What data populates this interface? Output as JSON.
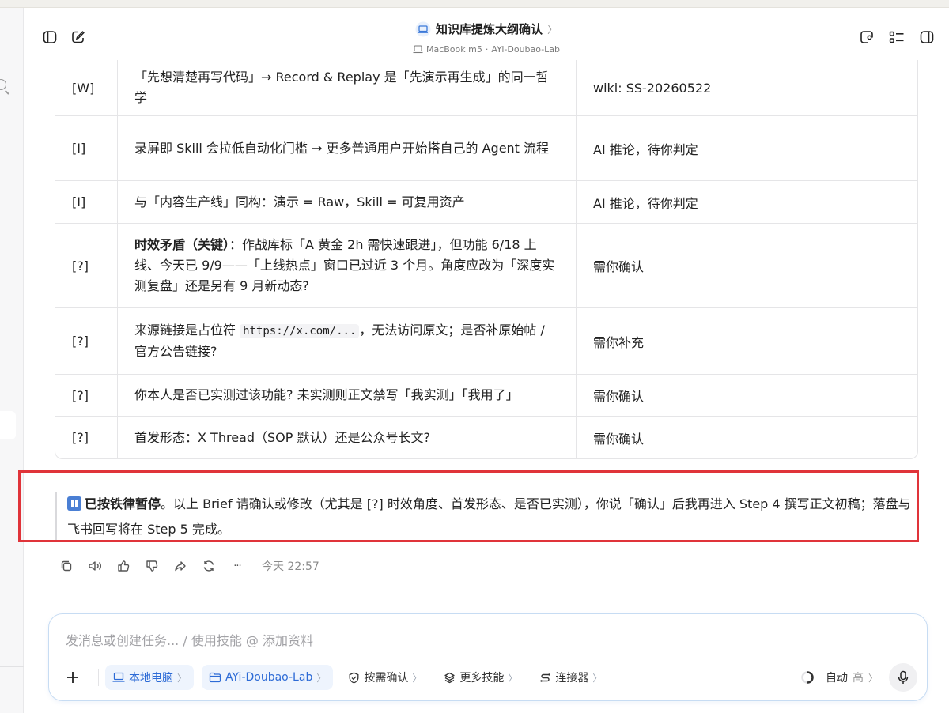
{
  "header": {
    "title": "知识库提炼大纲确认",
    "title_chevron": "〉",
    "device": "MacBook m5",
    "separator": "·",
    "workspace": "AYi-Doubao-Lab"
  },
  "table": {
    "rows": [
      {
        "tag": "[W]",
        "content": "「先想清楚再写代码」→ Record & Replay 是「先演示再生成」的同一哲学",
        "source": "wiki: SS-20260522"
      },
      {
        "tag": "[I]",
        "content": "录屏即 Skill 会拉低自动化门槛 → 更多普通用户开始搭自己的 Agent 流程",
        "source": "AI 推论，待你判定"
      },
      {
        "tag": "[I]",
        "content": "与「内容生产线」同构：演示 = Raw，Skill = 可复用资产",
        "source": "AI 推论，待你判定"
      },
      {
        "tag": "[?]",
        "bold": "时效矛盾（关键）",
        "content": "：作战库标「A 黄金 2h 需快速跟进」，但功能 6/18 上线、今天已 9/9——「上线热点」窗口已过近 3 个月。角度应改为「深度实测复盘」还是另有 9 月新动态?",
        "source": "需你确认"
      },
      {
        "tag": "[?]",
        "pre": "来源链接是占位符 ",
        "code": "https://x.com/...",
        "content": "，无法访问原文；是否补原始帖 / 官方公告链接?",
        "source": "需你补充"
      },
      {
        "tag": "[?]",
        "content": "你本人是否已实测过该功能? 未实测则正文禁写「我实测」「我用了」",
        "source": "需你确认"
      },
      {
        "tag": "[?]",
        "content": "首发形态：X Thread（SOP 默认）还是公众号长文?",
        "source": "需你确认"
      }
    ]
  },
  "note": {
    "bold": "已按铁律暂停",
    "text": "。以上 Brief 请确认或修改（尤其是 [?] 时效角度、首发形态、是否已实测），你说「确认」后我再进入 Step 4 撰写正文初稿；落盘与飞书回写将在 Step 5 完成。"
  },
  "actions": {
    "timestamp": "今天 22:57",
    "more": "···"
  },
  "composer": {
    "placeholder": "发消息或创建任务... / 使用技能 @ 添加资料",
    "chips": {
      "local": "本地电脑",
      "workspace": "AYi-Doubao-Lab",
      "confirm": "按需确认",
      "skills": "更多技能",
      "connectors": "连接器"
    },
    "chevron": "〉",
    "mode": "自动",
    "level": "高"
  },
  "colors": {
    "accent": "#2d6bd6",
    "highlight_border": "#e0343a",
    "chip_bg": "#eef4fd"
  }
}
